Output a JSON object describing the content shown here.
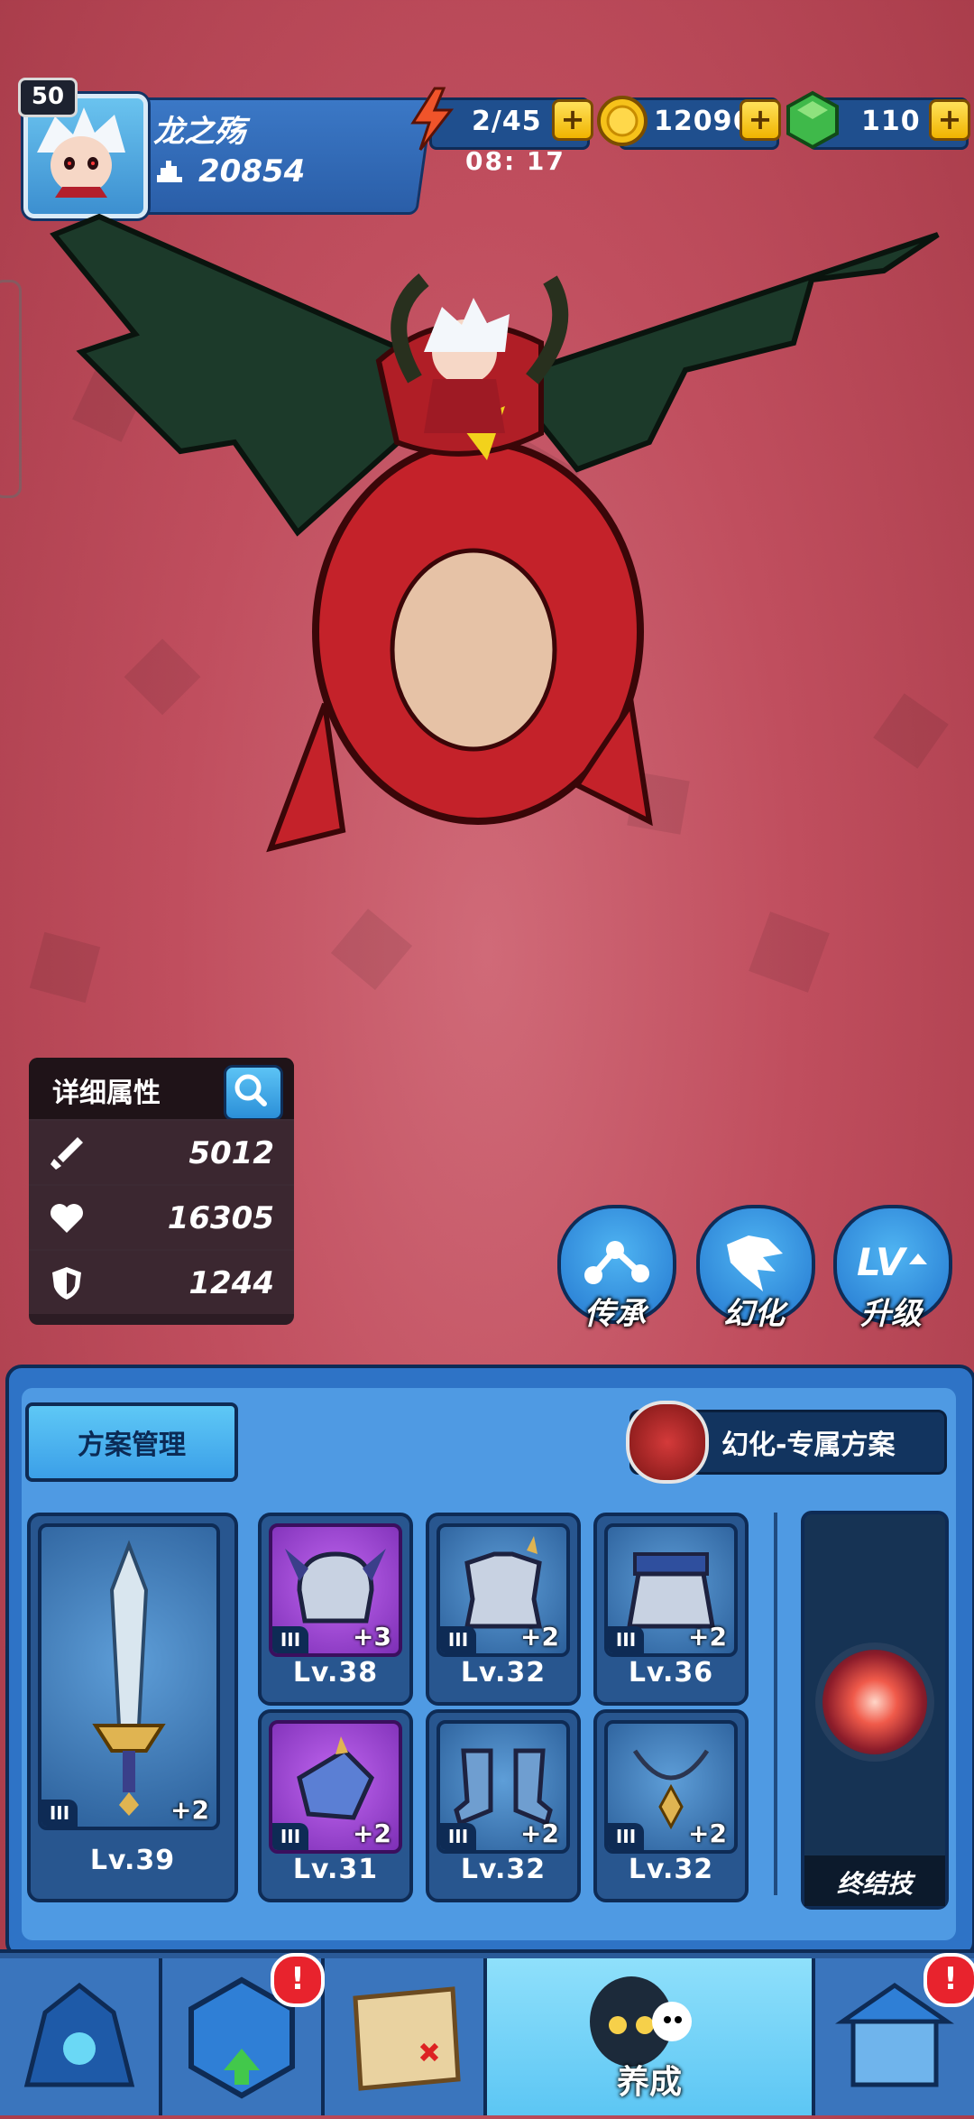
{
  "player": {
    "level": "50",
    "name": "龙之殇",
    "power": "20854"
  },
  "resources": {
    "stamina": "2/45",
    "stamina_timer": "08: 17",
    "gold": "12096",
    "gems": "110",
    "plus": "+"
  },
  "stats": {
    "title": "详细属性",
    "attack": "5012",
    "hp": "16305",
    "defense": "1244"
  },
  "actions": {
    "inherit": "传承",
    "transform": "幻化",
    "upgrade": "升级"
  },
  "panel": {
    "scheme_button": "方案管理",
    "skin_plan": "幻化-专属方案",
    "ultimate": "终结技"
  },
  "equipment": {
    "weapon": {
      "tier": "III",
      "plus": "+2",
      "level": "Lv.39"
    },
    "slots": [
      {
        "tier": "III",
        "plus": "+3",
        "level": "Lv.38",
        "rarity": "purple"
      },
      {
        "tier": "III",
        "plus": "+2",
        "level": "Lv.32",
        "rarity": "blue"
      },
      {
        "tier": "III",
        "plus": "+2",
        "level": "Lv.36",
        "rarity": "blue"
      },
      {
        "tier": "III",
        "plus": "+2",
        "level": "Lv.31",
        "rarity": "purple"
      },
      {
        "tier": "III",
        "plus": "+2",
        "level": "Lv.32",
        "rarity": "blue"
      },
      {
        "tier": "III",
        "plus": "+2",
        "level": "Lv.32",
        "rarity": "blue"
      }
    ]
  },
  "nav": {
    "active_label": "养成",
    "alert_mark": "!"
  },
  "colors": {
    "background": "#c04e5e",
    "panel": "#4f9ae3",
    "accent_gold": "#f0b400",
    "accent_green": "#3fb94a"
  }
}
